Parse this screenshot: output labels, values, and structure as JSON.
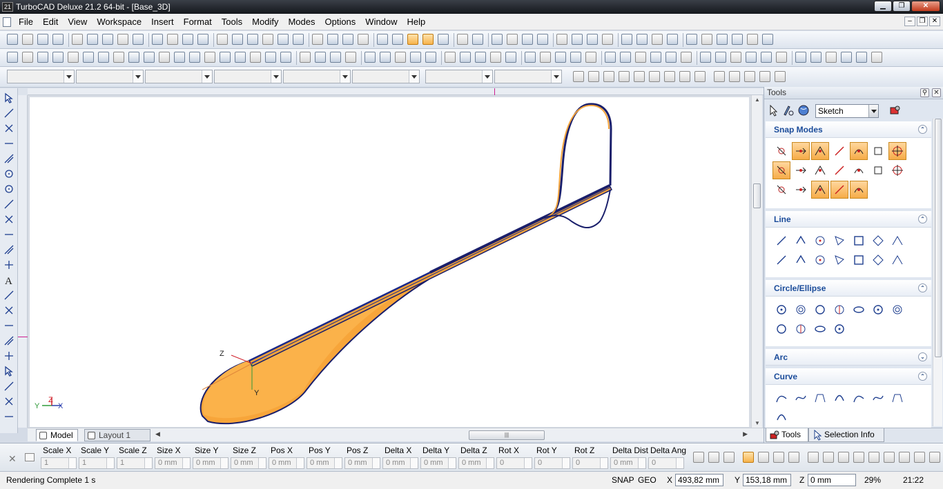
{
  "window": {
    "title": "TurboCAD Deluxe 21.2 64-bit - [Base_3D]",
    "app_icon_label": "21",
    "controls": [
      "minimize-icon",
      "maximize-icon",
      "close-icon"
    ]
  },
  "menu": {
    "items": [
      "File",
      "Edit",
      "View",
      "Workspace",
      "Insert",
      "Format",
      "Tools",
      "Modify",
      "Modes",
      "Options",
      "Window",
      "Help"
    ]
  },
  "canvas": {
    "axis_labels": {
      "z": "Z",
      "y": "Y",
      "corner_y": "Y",
      "corner_z": "Z",
      "corner_x": "X"
    },
    "colors": {
      "surface": "#f9ab3f",
      "edge": "#1a1f6b",
      "axis_red": "#d0202a",
      "axis_green": "#2f9a3a",
      "axis_blue": "#2b3fae"
    }
  },
  "tabs": {
    "model": "Model",
    "layout": "Layout 1"
  },
  "palette": {
    "title": "Tools",
    "mode": "Sketch",
    "sections": {
      "snap_modes": "Snap Modes",
      "line": "Line",
      "circle_ellipse": "Circle/Ellipse",
      "arc": "Arc",
      "curve": "Curve"
    },
    "tabs": {
      "tools": "Tools",
      "selection_info": "Selection Info"
    }
  },
  "inputbar": {
    "fields": [
      {
        "label": "Scale X",
        "value": "1"
      },
      {
        "label": "Scale Y",
        "value": "1"
      },
      {
        "label": "Scale Z",
        "value": "1"
      },
      {
        "label": "Size X",
        "value": "0 mm"
      },
      {
        "label": "Size Y",
        "value": "0 mm"
      },
      {
        "label": "Size Z",
        "value": "0 mm"
      },
      {
        "label": "Pos X",
        "value": "0 mm"
      },
      {
        "label": "Pos Y",
        "value": "0 mm"
      },
      {
        "label": "Pos Z",
        "value": "0 mm"
      },
      {
        "label": "Delta X",
        "value": "0 mm"
      },
      {
        "label": "Delta Y",
        "value": "0 mm"
      },
      {
        "label": "Delta Z",
        "value": "0 mm"
      },
      {
        "label": "Rot X",
        "value": "0"
      },
      {
        "label": "Rot Y",
        "value": "0"
      },
      {
        "label": "Rot Z",
        "value": "0"
      },
      {
        "label": "Delta Dist",
        "value": "0 mm"
      },
      {
        "label": "Delta Ang",
        "value": "0"
      }
    ]
  },
  "status": {
    "message": "Rendering Complete 1 s",
    "snap": "SNAP",
    "geo": "GEO",
    "x_label": "X",
    "y_label": "Y",
    "z_label": "Z",
    "x": "493,82 mm",
    "y": "153,18 mm",
    "z": "0 mm",
    "zoom": "29%",
    "time": "21:22"
  }
}
